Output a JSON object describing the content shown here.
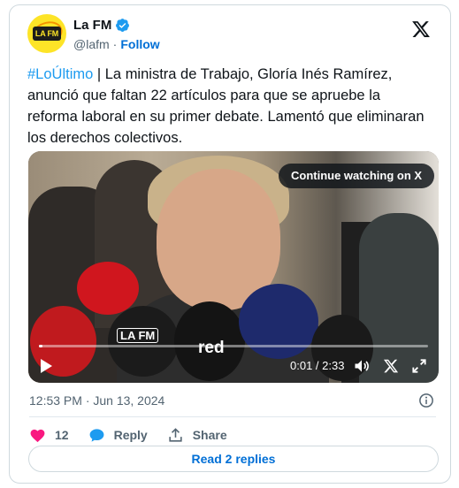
{
  "author": {
    "name": "La FM",
    "handle": "@lafm",
    "separator": "·",
    "follow_label": "Follow",
    "avatar_text": "LA FM"
  },
  "tweet": {
    "hashtag": "#LoÚltimo",
    "body": " | La ministra de Trabajo, Gloría Inés Ramírez, anunció que faltan 22 artículos para que se apruebe la reforma laboral en su primer debate. Lamentó que eliminaran los derechos colectivos."
  },
  "media": {
    "continue_label": "Continue watching on X",
    "time": "0:01 / 2:33",
    "progress": 0.007,
    "mic_labels": {
      "lafm": "LA FM",
      "red": "red"
    }
  },
  "meta": {
    "timestamp": "12:53 PM · Jun 13, 2024"
  },
  "actions": {
    "like_count": "12",
    "reply_label": "Reply",
    "share_label": "Share"
  },
  "replies_label": "Read 2 replies",
  "colors": {
    "link": "#1d9bf0",
    "follow": "#006fd6",
    "like": "#f91880",
    "verified": "#1d9bf0"
  },
  "icons": [
    "verified-badge-icon",
    "x-logo-icon",
    "play-icon",
    "volume-icon",
    "x-small-icon",
    "expand-icon",
    "info-icon",
    "heart-icon",
    "reply-bubble-icon",
    "share-icon"
  ]
}
